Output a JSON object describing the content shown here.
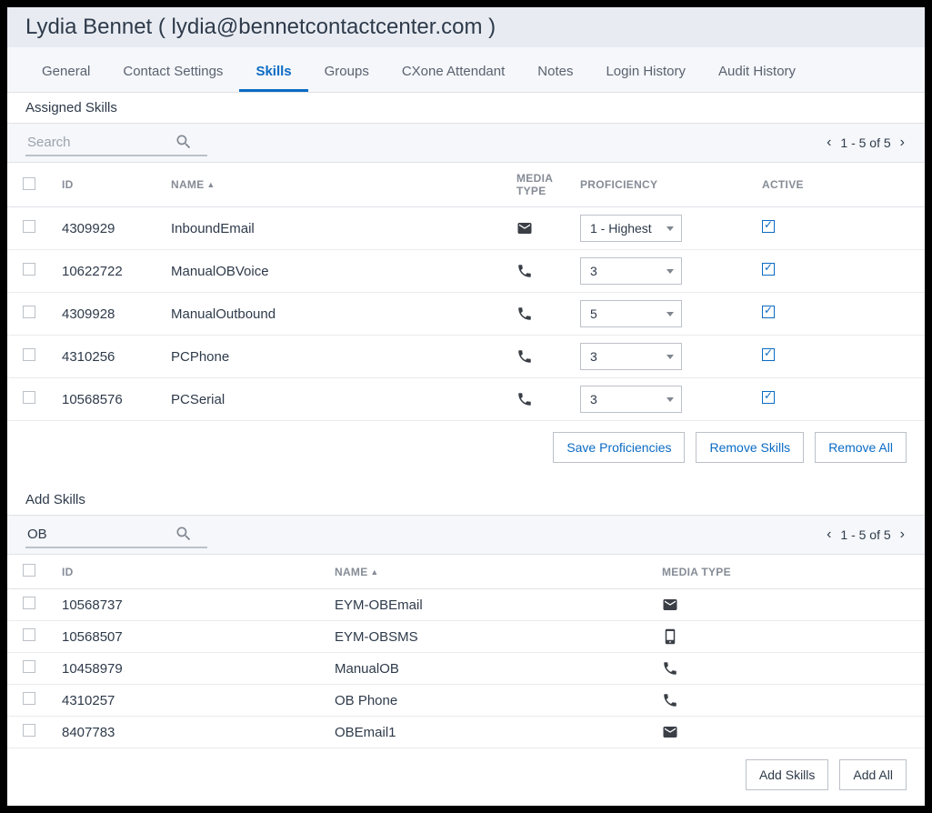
{
  "header": {
    "title": "Lydia Bennet ( lydia@bennetcontactcenter.com )"
  },
  "tabs": [
    {
      "label": "General"
    },
    {
      "label": "Contact Settings"
    },
    {
      "label": "Skills"
    },
    {
      "label": "Groups"
    },
    {
      "label": "CXone Attendant"
    },
    {
      "label": "Notes"
    },
    {
      "label": "Login History"
    },
    {
      "label": "Audit History"
    }
  ],
  "tabs_active_index": 2,
  "assigned": {
    "title": "Assigned Skills",
    "search_placeholder": "Search",
    "search_value": "",
    "pager": "1 - 5 of 5",
    "columns": {
      "id": "ID",
      "name": "NAME",
      "media": "MEDIA TYPE",
      "prof": "PROFICIENCY",
      "active": "ACTIVE"
    },
    "rows": [
      {
        "id": "4309929",
        "name": "InboundEmail",
        "media": "email",
        "prof": "1 - Highest",
        "active": true
      },
      {
        "id": "10622722",
        "name": "ManualOBVoice",
        "media": "phone",
        "prof": "3",
        "active": true
      },
      {
        "id": "4309928",
        "name": "ManualOutbound",
        "media": "phone",
        "prof": "5",
        "active": true
      },
      {
        "id": "4310256",
        "name": "PCPhone",
        "media": "phone",
        "prof": "3",
        "active": true
      },
      {
        "id": "10568576",
        "name": "PCSerial",
        "media": "phone",
        "prof": "3",
        "active": true
      }
    ],
    "buttons": {
      "save": "Save Proficiencies",
      "remove": "Remove Skills",
      "remove_all": "Remove All"
    }
  },
  "add": {
    "title": "Add Skills",
    "search_value": "OB",
    "pager": "1 - 5 of 5",
    "columns": {
      "id": "ID",
      "name": "NAME",
      "media": "MEDIA TYPE"
    },
    "rows": [
      {
        "id": "10568737",
        "name": "EYM-OBEmail",
        "media": "email"
      },
      {
        "id": "10568507",
        "name": "EYM-OBSMS",
        "media": "mobile"
      },
      {
        "id": "10458979",
        "name": "ManualOB",
        "media": "phone"
      },
      {
        "id": "4310257",
        "name": "OB Phone",
        "media": "phone"
      },
      {
        "id": "8407783",
        "name": "OBEmail1",
        "media": "email"
      }
    ],
    "buttons": {
      "add": "Add Skills",
      "add_all": "Add All"
    }
  }
}
